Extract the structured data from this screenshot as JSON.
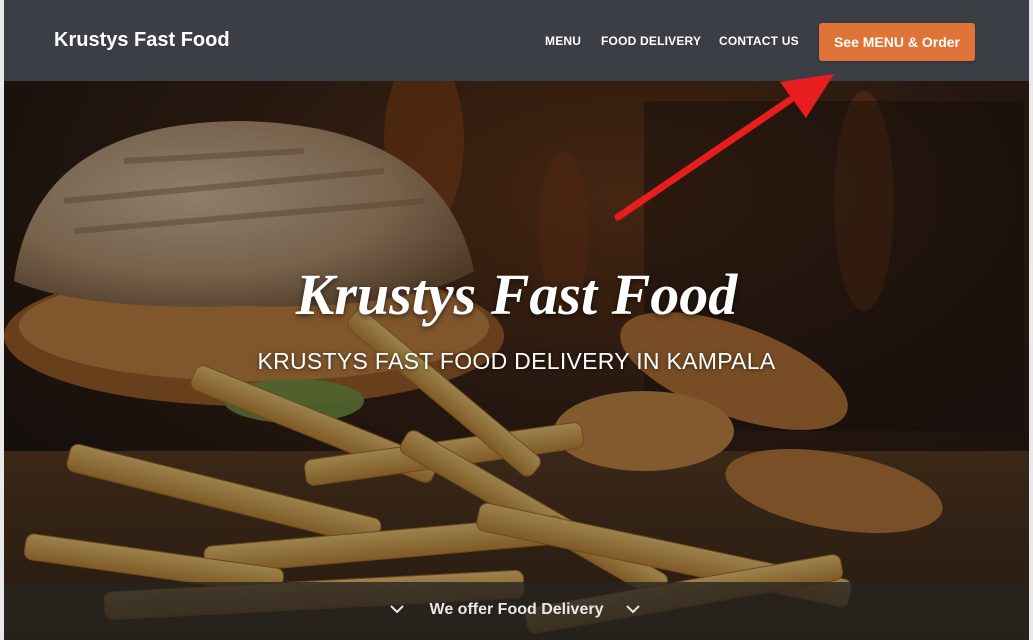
{
  "navbar": {
    "brand": "Krustys Fast Food",
    "links": [
      {
        "label": "MENU"
      },
      {
        "label": "FOOD DELIVERY"
      },
      {
        "label": "CONTACT US"
      }
    ],
    "cta_label": "See MENU & Order",
    "background": "#3b3e44",
    "cta_color": "#e07338"
  },
  "hero": {
    "title": "Krustys Fast Food",
    "subtitle": "KRUSTYS FAST FOOD DELIVERY IN KAMPALA",
    "image": "burger-and-fries-photo"
  },
  "bottom": {
    "text": "We offer Food Delivery",
    "icon": "chevron-down-icon"
  },
  "annotation": {
    "icon": "red-arrow",
    "color": "#e81d1d"
  }
}
